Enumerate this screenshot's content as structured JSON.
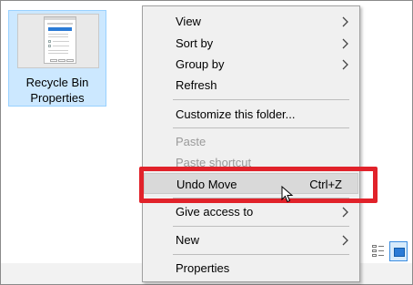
{
  "desktop": {
    "file": {
      "label_line1": "Recycle Bin",
      "label_line2": "Properties",
      "selected": true
    }
  },
  "context_menu": {
    "items": [
      {
        "id": "view",
        "label": "View",
        "submenu": true
      },
      {
        "id": "sort_by",
        "label": "Sort by",
        "submenu": true
      },
      {
        "id": "group_by",
        "label": "Group by",
        "submenu": true
      },
      {
        "id": "refresh",
        "label": "Refresh"
      },
      {
        "id": "customize",
        "label": "Customize this folder..."
      },
      {
        "id": "paste",
        "label": "Paste",
        "disabled": true
      },
      {
        "id": "paste_shortcut",
        "label": "Paste shortcut",
        "disabled": true
      },
      {
        "id": "undo_move",
        "label": "Undo Move",
        "shortcut": "Ctrl+Z",
        "hovered": true
      },
      {
        "id": "give_access",
        "label": "Give access to",
        "submenu": true
      },
      {
        "id": "new",
        "label": "New",
        "submenu": true
      },
      {
        "id": "properties",
        "label": "Properties"
      }
    ]
  },
  "annotation": {
    "color": "#e1222a",
    "target": "undo_move"
  },
  "view_toggle": {
    "active": "large-icons"
  }
}
